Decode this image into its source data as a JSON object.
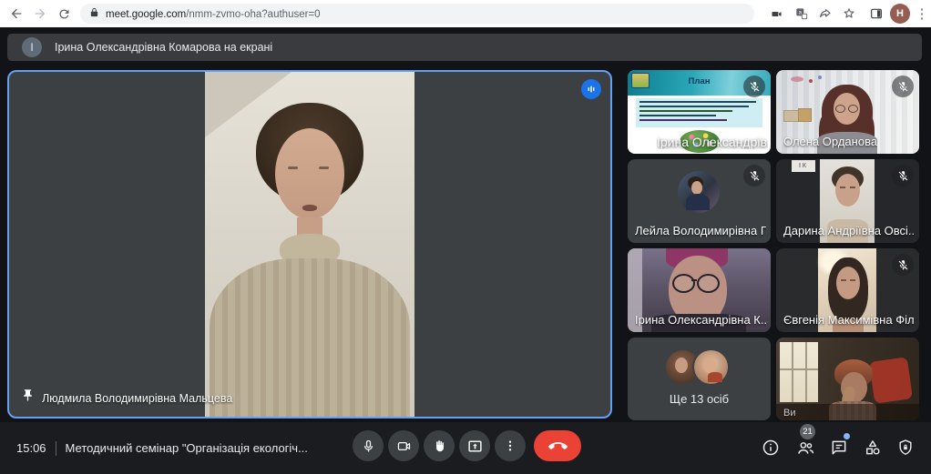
{
  "browser": {
    "url_domain": "meet.google.com",
    "url_path": "/nmm-zvmo-oha?authuser=0",
    "profile_letter": "H"
  },
  "banner": {
    "avatar_letter": "І",
    "message": "Ірина Олександрівна Комарова на екрані"
  },
  "main_video": {
    "name": "Людмила Володимирівна Мальцева"
  },
  "tiles": [
    {
      "name": "Ірина Олександрів...",
      "slide_title": "План"
    },
    {
      "name": "Олена Орданова"
    },
    {
      "name": "Лейла Володимирівна Гі..."
    },
    {
      "name": "Дарина Андріївна Овсі...",
      "sign_text": "ІК"
    },
    {
      "name": "Ірина Олександрівна К..."
    },
    {
      "name": "Євгенія Максимівна Філ..."
    },
    {
      "name": "Ще 13 осіб"
    },
    {
      "name": "Ви"
    }
  ],
  "bottom_bar": {
    "time": "15:06",
    "meeting_title": "Методичний семінар \"Організація екологіч...",
    "participants_count": "21"
  },
  "colors": {
    "accent_blue": "#1a73e8",
    "speaking_border": "#64a0f4",
    "end_call_red": "#ea4335",
    "tile_bg": "#3c4043",
    "chat_notification_blue": "#8ab4f8"
  }
}
